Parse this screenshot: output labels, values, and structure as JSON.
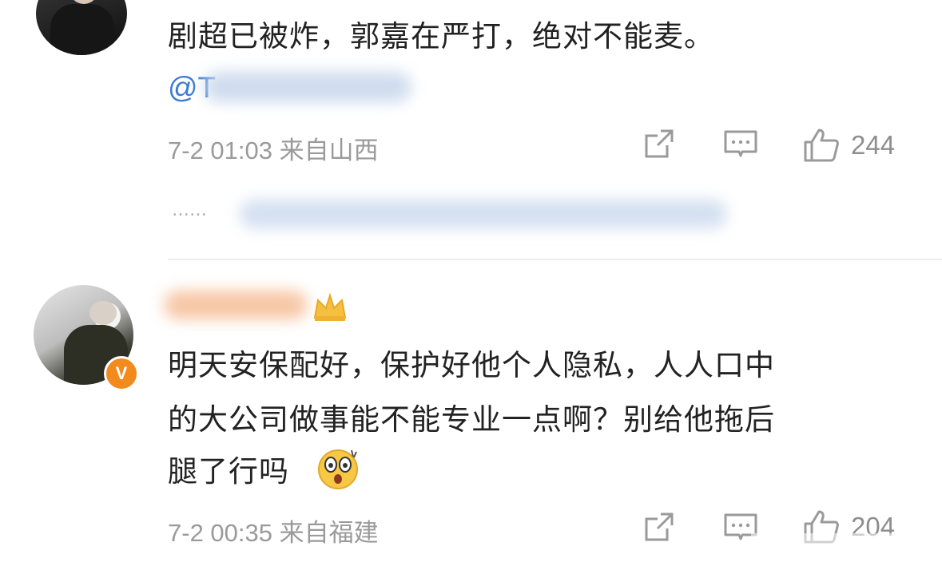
{
  "comments": [
    {
      "text": "剧超已被炸，郭嘉在严打，绝对不能麦。",
      "mention": "@T",
      "meta": "7-2 01:03 来自山西",
      "likes": "244",
      "thread_dots": "……"
    },
    {
      "text_line1": "明天安保配好，保护好他个人隐私，人人口中",
      "text_line2": "的大公司做事能不能专业一点啊？别给他拖后",
      "text_line3": "腿了行吗",
      "verified_badge": "V",
      "meta": "7-2 00:35 来自福建",
      "likes": "204"
    }
  ],
  "colors": {
    "mention": "#3d7bd1",
    "meta": "#9a9a9a",
    "badge": "#f28a1c"
  },
  "icons": [
    "share-icon",
    "comment-icon",
    "like-icon",
    "emoji-shocked-icon",
    "crown-icon",
    "verified-icon"
  ]
}
